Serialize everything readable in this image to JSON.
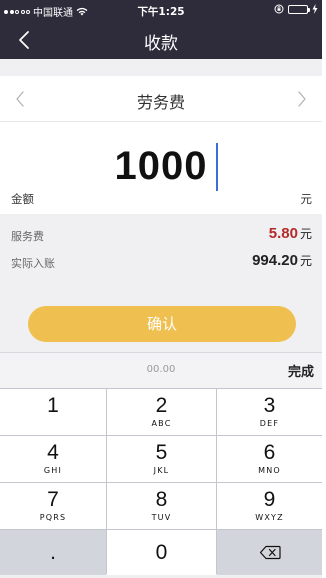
{
  "status_bar": {
    "carrier": "中国联通",
    "time": "下午1:25",
    "signal_dots_full": 2,
    "signal_dots_total": 5,
    "battery_level": 1.0,
    "icons": [
      "signal-dots-icon",
      "wifi-icon",
      "orientation-lock-icon",
      "battery-icon",
      "charging-icon"
    ]
  },
  "nav": {
    "title": "收款",
    "back_icon": "chevron-left-icon"
  },
  "category": {
    "label": "劳务费",
    "prev_icon": "chevron-left-icon",
    "next_icon": "chevron-right-icon"
  },
  "amount": {
    "label": "金额",
    "value": "1000",
    "unit": "元"
  },
  "fees": {
    "service_fee_label": "服务费",
    "service_fee_value": "5.80",
    "service_fee_unit": "元",
    "actual_label": "实际入账",
    "actual_value": "994.20",
    "actual_unit": "元",
    "colors": {
      "service_fee": "#b52a2a"
    }
  },
  "confirm": {
    "label": "确认",
    "color": "#efc04f"
  },
  "keyboard": {
    "preview": "00.00",
    "done_label": "完成",
    "keys": [
      {
        "num": "1",
        "sub": ""
      },
      {
        "num": "2",
        "sub": "ABC"
      },
      {
        "num": "3",
        "sub": "DEF"
      },
      {
        "num": "4",
        "sub": "GHI"
      },
      {
        "num": "5",
        "sub": "JKL"
      },
      {
        "num": "6",
        "sub": "MNO"
      },
      {
        "num": "7",
        "sub": "PQRS"
      },
      {
        "num": "8",
        "sub": "TUV"
      },
      {
        "num": "9",
        "sub": "WXYZ"
      },
      {
        "num": ".",
        "sub": ""
      },
      {
        "num": "0",
        "sub": ""
      },
      {
        "num": "",
        "sub": "",
        "icon": "backspace-icon"
      }
    ]
  },
  "colors": {
    "header_bg": "#2e2b3a",
    "cursor": "#3a6fd8"
  }
}
